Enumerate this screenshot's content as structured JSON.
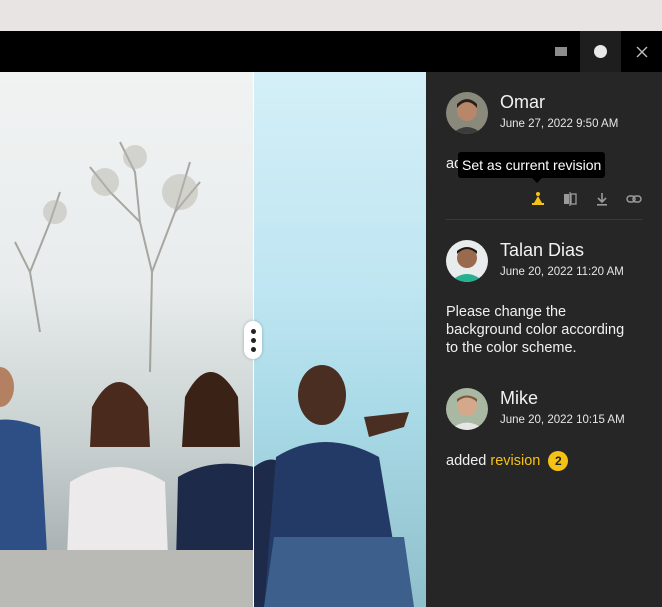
{
  "window": {
    "minimize_icon": "minimize-icon",
    "record_icon": "record-icon",
    "close_icon": "close-icon"
  },
  "viewer": {
    "compare_handle_icon": "vertical-dots-icon"
  },
  "comments": [
    {
      "name": "Omar",
      "date": "June 27, 2022 9:50 AM",
      "text_start": "ad",
      "tooltip": "Set as current revision",
      "actions": [
        "set-current-revision-icon",
        "compare-icon",
        "download-icon",
        "link-icon"
      ]
    },
    {
      "name": "Talan Dias",
      "date": "June 20, 2022 11:20 AM",
      "text_lines": [
        "Please change the",
        "background color according",
        "to the color scheme."
      ]
    },
    {
      "name": "Mike",
      "date": "June 20, 2022 10:15 AM",
      "text_prefix": "added",
      "link_text": "revision",
      "badge": "2"
    }
  ],
  "colors": {
    "accent": "#f5c314",
    "panel_bg": "#262626",
    "titlebar_bg": "#000000"
  }
}
